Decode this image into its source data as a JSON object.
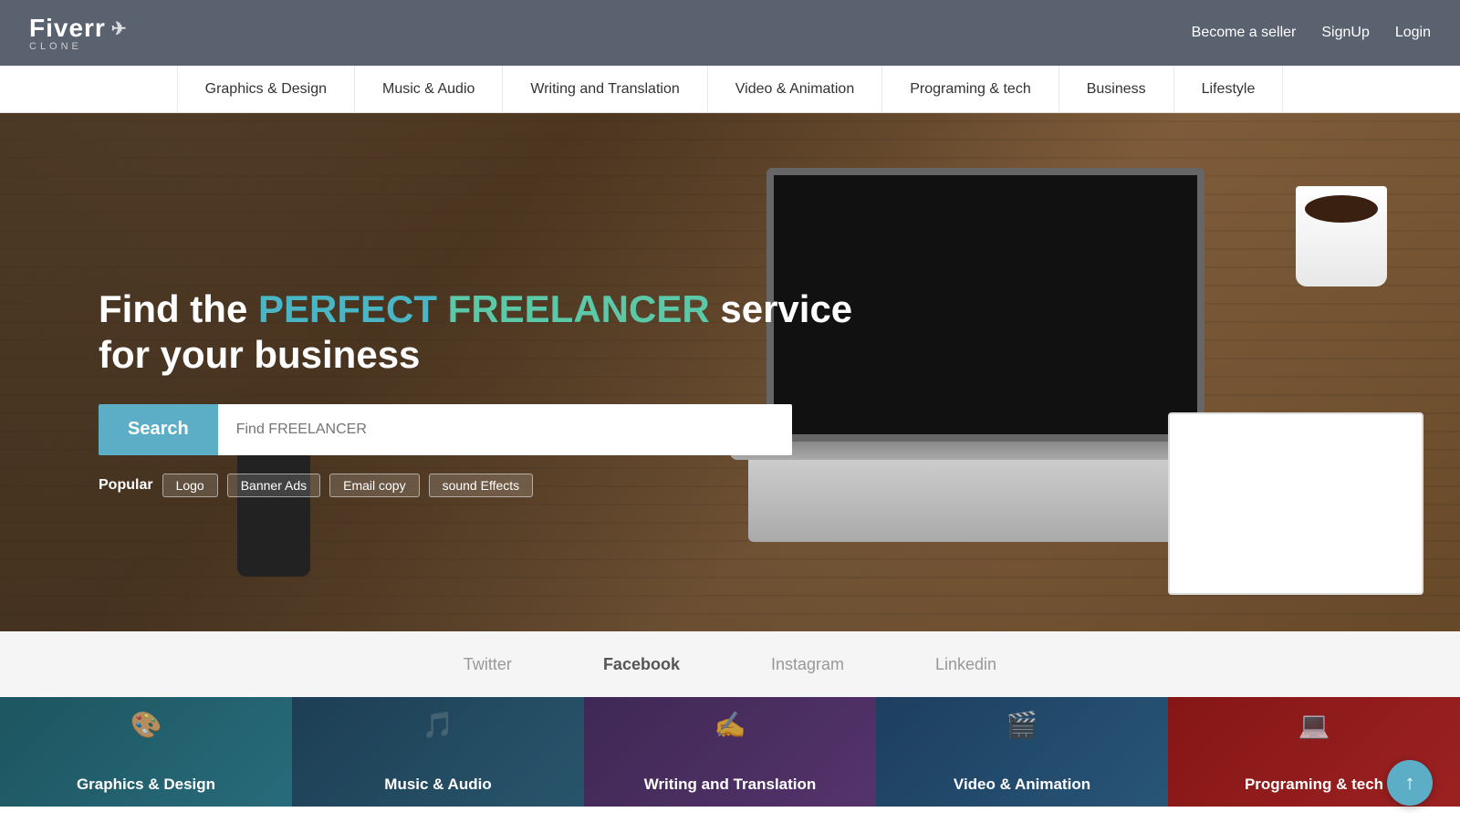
{
  "header": {
    "logo": {
      "main": "Fiverr",
      "sub": "CLONE",
      "icon": "✈"
    },
    "nav": [
      {
        "label": "Become a seller"
      },
      {
        "label": "SignUp"
      },
      {
        "label": "Login"
      }
    ]
  },
  "navbar": {
    "items": [
      {
        "label": "Graphics & Design"
      },
      {
        "label": "Music & Audio"
      },
      {
        "label": "Writing and Translation"
      },
      {
        "label": "Video & Animation"
      },
      {
        "label": "Programing & tech"
      },
      {
        "label": "Business"
      },
      {
        "label": "Lifestyle"
      }
    ]
  },
  "hero": {
    "headline_part1": "Find the ",
    "headline_perfect": "PERFECT ",
    "headline_freelancer": "FREELANCER",
    "headline_part2": " service for your business",
    "search_placeholder": "Find FREELANCER",
    "search_button": "Search",
    "popular_label": "Popular",
    "popular_tags": [
      {
        "label": "Logo"
      },
      {
        "label": "Banner Ads"
      },
      {
        "label": "Email copy"
      },
      {
        "label": "sound Effects"
      }
    ]
  },
  "social": {
    "links": [
      {
        "label": "Twitter",
        "active": false
      },
      {
        "label": "Facebook",
        "active": true
      },
      {
        "label": "Instagram",
        "active": false
      },
      {
        "label": "Linkedin",
        "active": false
      }
    ]
  },
  "cards": [
    {
      "label": "Graphics & Design",
      "bg_class": "card-bg-1",
      "icon": "🎨"
    },
    {
      "label": "Music & Audio",
      "bg_class": "card-bg-2",
      "icon": "🎵"
    },
    {
      "label": "Writing and Translation",
      "bg_class": "card-bg-3",
      "icon": "✍"
    },
    {
      "label": "Video & Animation",
      "bg_class": "card-bg-4",
      "icon": "🎬"
    },
    {
      "label": "Programing & tech",
      "bg_class": "card-bg-5",
      "icon": "💻"
    }
  ],
  "scroll_btn": "↑"
}
